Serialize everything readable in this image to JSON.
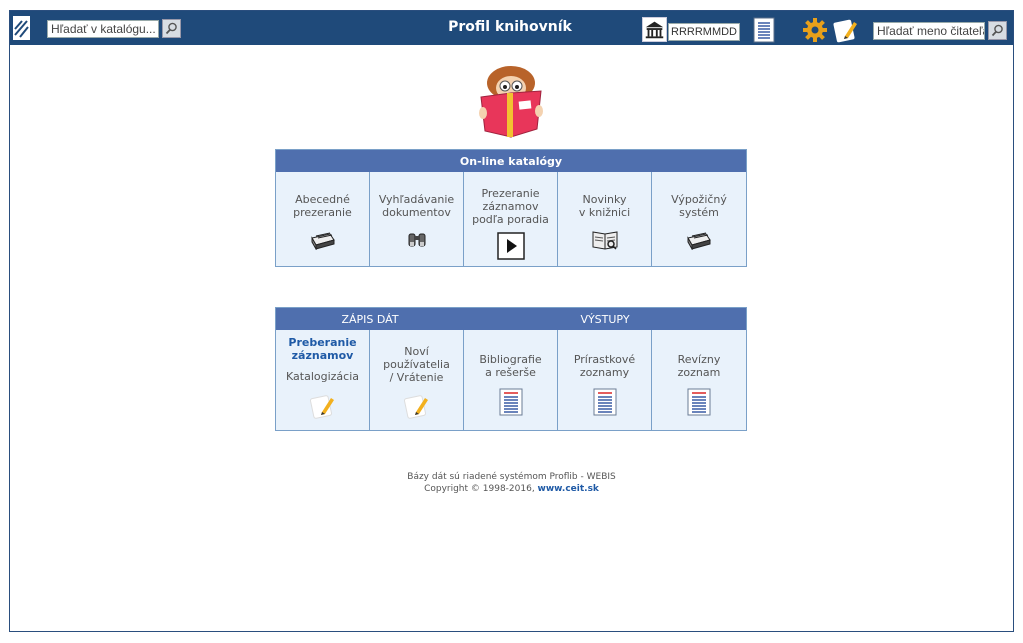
{
  "header": {
    "title": "Profil knihovník",
    "search_catalog_placeholder": "Hľadať v katalógu...",
    "date_value": "RRRRMMDD",
    "search_reader_placeholder": "Hľadať meno čitateľa."
  },
  "online_catalogs": {
    "heading": "On-line katalógy",
    "items": [
      {
        "line1": "Abecedné",
        "line2": "prezeranie",
        "line3": "",
        "icon": "card-catalog-icon"
      },
      {
        "line1": "Vyhľadávanie",
        "line2": "dokumentov",
        "line3": "",
        "icon": "binoculars-icon"
      },
      {
        "line1": "Prezeranie",
        "line2": "záznamov",
        "line3": "podľa poradia",
        "icon": "play-icon"
      },
      {
        "line1": "Novinky",
        "line2": "v knižnici",
        "line3": "",
        "icon": "open-book-icon"
      },
      {
        "line1": "Výpožičný",
        "line2": "systém",
        "line3": "",
        "icon": "card-catalog-icon"
      }
    ]
  },
  "data_panel": {
    "heading_left": "ZÁPIS DÁT",
    "heading_right": "VÝSTUPY",
    "items": [
      {
        "bold1": "Preberanie",
        "bold2": "záznamov",
        "line1": "Katalogizácia",
        "icon": "edit-icon"
      },
      {
        "line1": "Noví",
        "line2": "používatelia",
        "line3": "/ Vrátenie",
        "icon": "edit-icon"
      },
      {
        "line1": "Bibliografie",
        "line2": "a rešerše",
        "icon": "report-icon"
      },
      {
        "line1": "Prírastkové",
        "line2": "zoznamy",
        "icon": "report-icon"
      },
      {
        "line1": "Revízny",
        "line2": "zoznam",
        "icon": "report-icon"
      }
    ]
  },
  "footer": {
    "line1": "Bázy dát sú riadené systémom Proflib - WEBIS",
    "line2_prefix": "Copyright © 1998-2016, ",
    "link": "www.ceit.sk"
  },
  "colors": {
    "topbar": "#1f4a7a",
    "panel_header": "#4f6fae",
    "panel_bg": "#e9f2fb",
    "link": "#1f5aa6"
  }
}
